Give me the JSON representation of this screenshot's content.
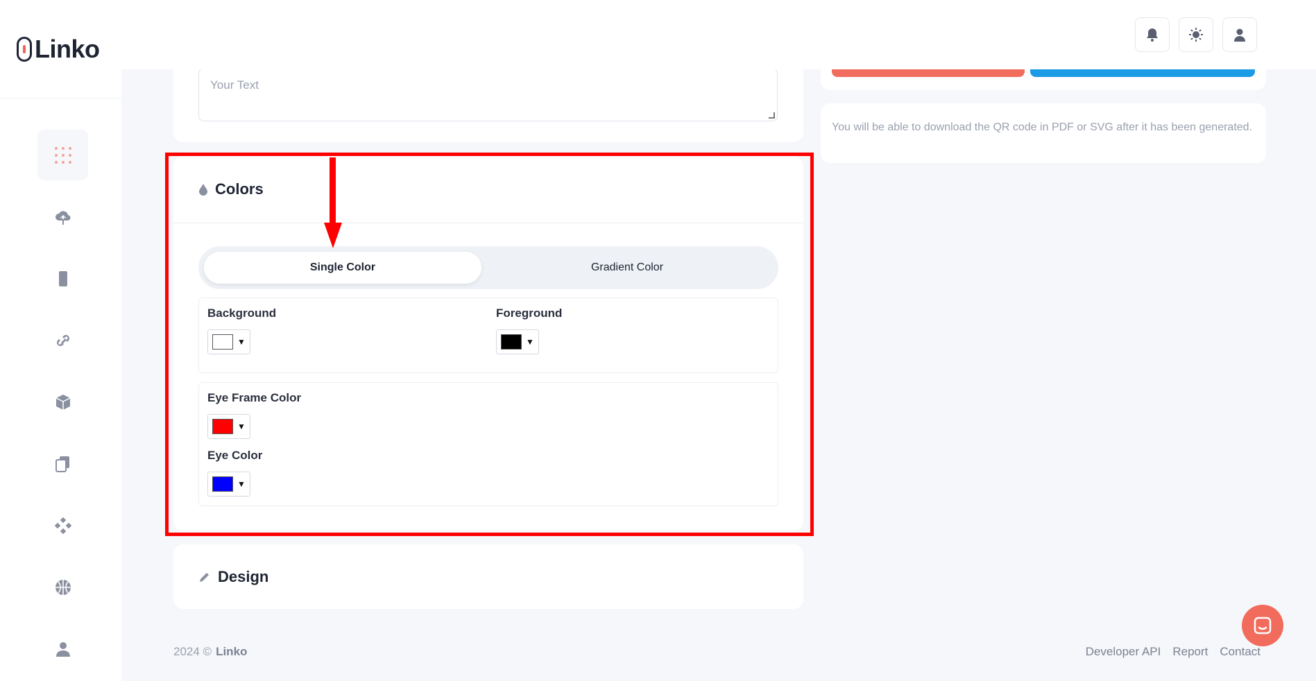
{
  "app": {
    "logo_text": "Linko"
  },
  "sidebar": {
    "items": [
      {
        "name": "dashboard",
        "icon": "grid-dots-icon",
        "active": true
      },
      {
        "name": "upload",
        "icon": "cloud-upload-icon"
      },
      {
        "name": "device",
        "icon": "phone-icon"
      },
      {
        "name": "links",
        "icon": "link-icon"
      },
      {
        "name": "projects",
        "icon": "cube-icon"
      },
      {
        "name": "pages",
        "icon": "copy-icon"
      },
      {
        "name": "integrations",
        "icon": "diamond-dots-icon"
      },
      {
        "name": "domains",
        "icon": "globe-icon"
      },
      {
        "name": "account",
        "icon": "user-icon"
      }
    ]
  },
  "header": {
    "buttons": [
      "bell-icon",
      "sun-icon",
      "user-icon"
    ]
  },
  "text_card": {
    "placeholder": "Your Text"
  },
  "colors": {
    "title": "Colors",
    "icon": "drop-icon",
    "toggle": {
      "single": "Single Color",
      "gradient": "Gradient Color",
      "selected": "single"
    },
    "background": {
      "label": "Background",
      "value": "#ffffff"
    },
    "foreground": {
      "label": "Foreground",
      "value": "#000000"
    },
    "eye_frame": {
      "label": "Eye Frame Color",
      "value": "#ff0000"
    },
    "eye": {
      "label": "Eye Color",
      "value": "#0000ff"
    }
  },
  "design": {
    "title": "Design",
    "icon": "pencil-icon"
  },
  "right": {
    "info_text": "You will be able to download the QR code in PDF or SVG after it has been generated."
  },
  "footer": {
    "copyright": "2024 ©",
    "brand": "Linko",
    "links": [
      "Developer API",
      "Report",
      "Contact"
    ]
  },
  "colors_theme": {
    "accent_red": "#f26c5d",
    "accent_blue": "#1a9be6",
    "highlight": "#ff0000"
  }
}
